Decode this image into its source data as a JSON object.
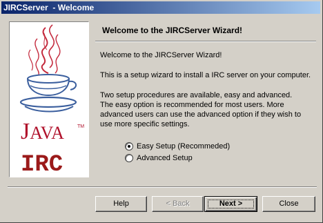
{
  "window": {
    "title": "JIRCServer  - Welcome"
  },
  "branding": {
    "java_logo_icon": "java-coffee-cup-icon",
    "java_big_j": "J",
    "java_rest": "AVA",
    "java_tm": "TM",
    "irc_text": "IRC",
    "brand_color": "#b0112b"
  },
  "header": {
    "title": "Welcome to the JIRCServer Wizard!"
  },
  "body": {
    "paragraph1": "Welcome to the JIRCServer Wizard!",
    "paragraph2": "This is a setup wizard to install a IRC server on your computer.",
    "paragraph3_line1": "Two setup procedures are available, easy and advanced.",
    "paragraph3_line2": "The easy option is recommended for most users. More",
    "paragraph3_line3": "advanced users can use the advanced option if they wish to",
    "paragraph3_line4": "use more specific settings."
  },
  "options": {
    "easy_label": "Easy Setup (Recommeded)",
    "easy_selected": true,
    "advanced_label": "Advanced Setup",
    "advanced_selected": false
  },
  "buttons": {
    "help": "Help",
    "back": "< Back",
    "next": "Next >",
    "close": "Close"
  }
}
